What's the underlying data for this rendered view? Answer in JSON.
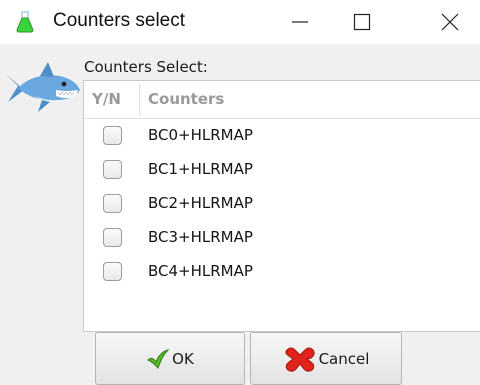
{
  "window": {
    "title": "Counters select",
    "icon": "flask-icon",
    "controls": [
      "minimize-icon",
      "maximize-icon",
      "close-icon"
    ]
  },
  "group": {
    "label": "Counters Select:"
  },
  "table": {
    "columns": [
      "Y/N",
      "Counters"
    ],
    "rows": [
      {
        "checked": false,
        "label": "BC0+HLRMAP"
      },
      {
        "checked": false,
        "label": "BC1+HLRMAP"
      },
      {
        "checked": false,
        "label": "BC2+HLRMAP"
      },
      {
        "checked": false,
        "label": "BC3+HLRMAP"
      },
      {
        "checked": false,
        "label": "BC4+HLRMAP"
      }
    ]
  },
  "buttons": {
    "ok": {
      "label": "OK",
      "icon": "green-check-arrow-icon"
    },
    "cancel": {
      "label": "Cancel",
      "icon": "red-x-icon"
    }
  }
}
